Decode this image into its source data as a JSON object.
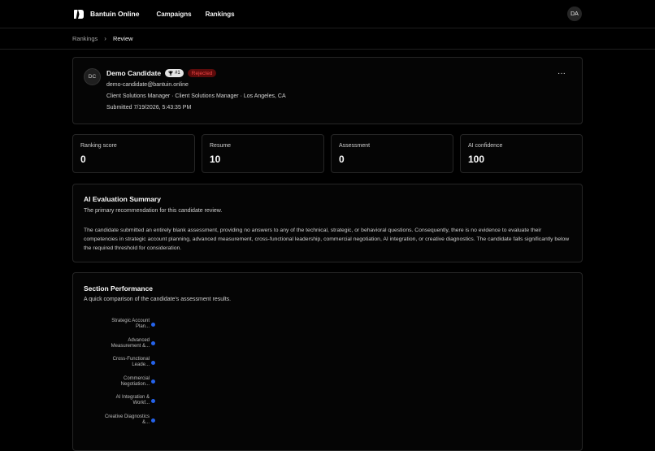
{
  "app": {
    "brand": "Bantuin Online",
    "avatar_initials": "DA"
  },
  "nav": {
    "items": [
      "Campaigns",
      "Rankings"
    ]
  },
  "breadcrumb": {
    "parent": "Rankings",
    "separator": "›",
    "current": "Review"
  },
  "candidate": {
    "initials": "DC",
    "name": "Demo Candidate",
    "rank": "#1",
    "status": "Rejected",
    "email": "demo-candidate@bantuin.online",
    "role_line": "Client Solutions Manager · Client Solutions Manager · Los Angeles, CA",
    "submitted": "Submitted 7/19/2026, 5:43:35 PM",
    "more_label": "···"
  },
  "stats": [
    {
      "label": "Ranking score",
      "value": "0"
    },
    {
      "label": "Resume",
      "value": "10"
    },
    {
      "label": "Assessment",
      "value": "0"
    },
    {
      "label": "AI confidence",
      "value": "100"
    }
  ],
  "summary": {
    "title": "AI Evaluation Summary",
    "subtitle": "The primary recommendation for this candidate review.",
    "body": "The candidate submitted an entirely blank assessment, providing no answers to any of the technical, strategic, or behavioral questions. Consequently, there is no evidence to evaluate their competencies in strategic account planning, advanced measurement, cross-functional leadership, commercial negotiation, AI integration, or creative diagnostics. The candidate falls significantly below the required threshold for consideration."
  },
  "performance": {
    "title": "Section Performance",
    "subtitle": "A quick comparison of the candidate's assessment results."
  },
  "chart_data": {
    "type": "bar",
    "categories": [
      "Strategic Account Plan...",
      "Advanced Measurement &...",
      "Cross-Functional Leade...",
      "Commercial Negotiation...",
      "AI Integration & Workf...",
      "Creative Diagnostics &..."
    ],
    "category_lines": [
      [
        "Strategic Account",
        "Plan..."
      ],
      [
        "Advanced",
        "Measurement &..."
      ],
      [
        "Cross-Functional",
        "Leade..."
      ],
      [
        "Commercial",
        "Negotiation..."
      ],
      [
        "AI Integration &",
        "Workf..."
      ],
      [
        "Creative Diagnostics",
        "&..."
      ]
    ],
    "values": [
      0,
      0,
      0,
      0,
      0,
      0
    ],
    "bar_color": "#2563eb"
  },
  "colors": {
    "accent": "#2563eb",
    "danger": "#ef4444",
    "danger_bg": "#5c0b0b"
  }
}
